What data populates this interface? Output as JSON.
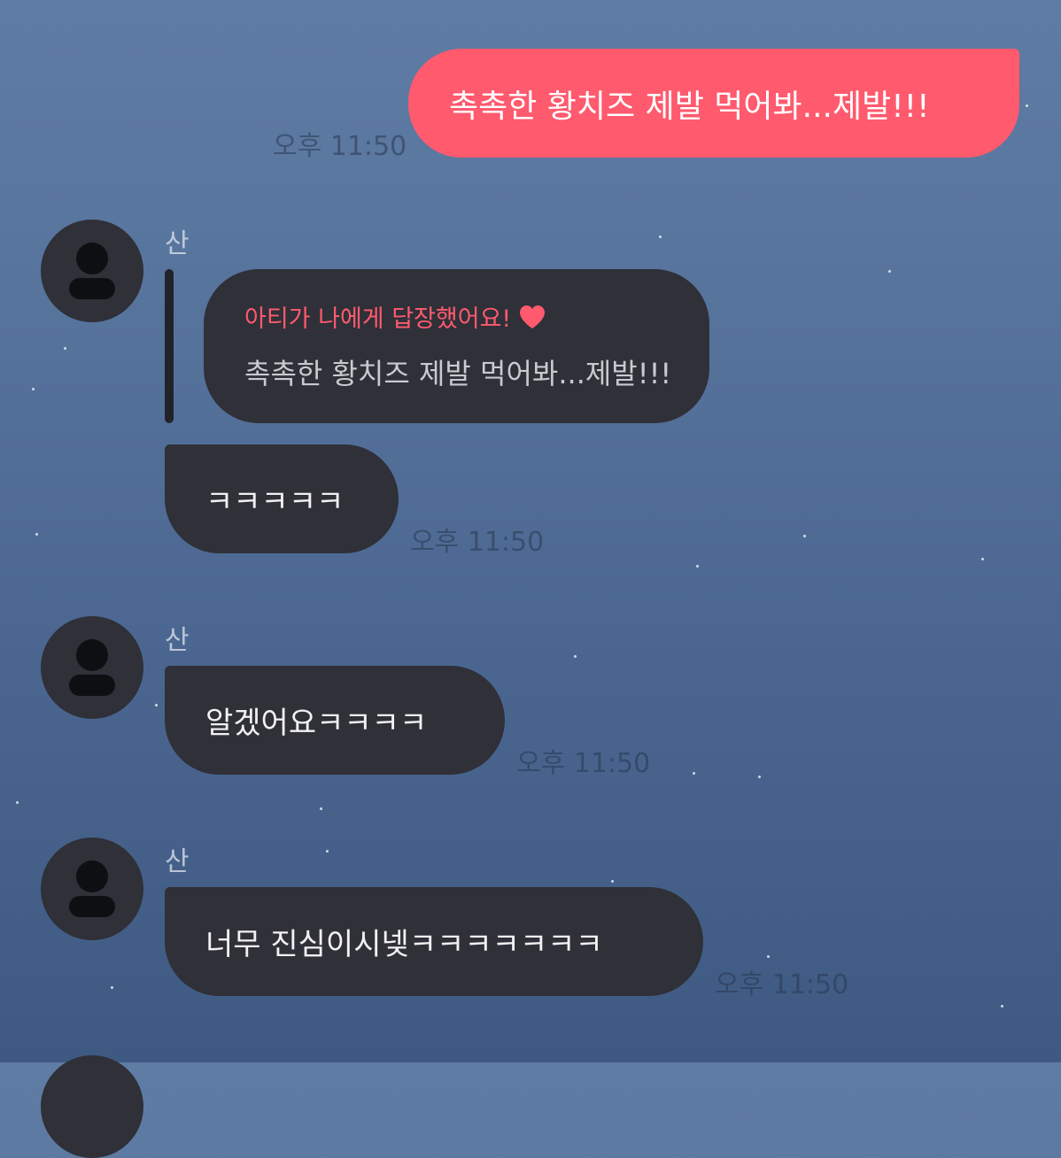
{
  "colors": {
    "accent": "#ff5a6e",
    "received_bubble": "#2f3038",
    "background": "#56739c"
  },
  "messages": [
    {
      "type": "sent",
      "text": "촉촉한 황치즈 제발 먹어봐...제발!!!",
      "time": "오후 11:50"
    },
    {
      "type": "received",
      "sender": "산",
      "reply": {
        "title": "아티가 나에게 답장했어요!",
        "icon": "heart-icon",
        "quoted": "촉촉한 황치즈 제발 먹어봐...제발!!!"
      },
      "text": "ㅋㅋㅋㅋㅋ",
      "time": "오후 11:50"
    },
    {
      "type": "received",
      "sender": "산",
      "text": "알겠어요ㅋㅋㅋㅋ",
      "time": "오후 11:50"
    },
    {
      "type": "received",
      "sender": "산",
      "text": "너무 진심이시넺ㅋㅋㅋㅋㅋㅋㅋ",
      "time": "오후 11:50"
    }
  ]
}
